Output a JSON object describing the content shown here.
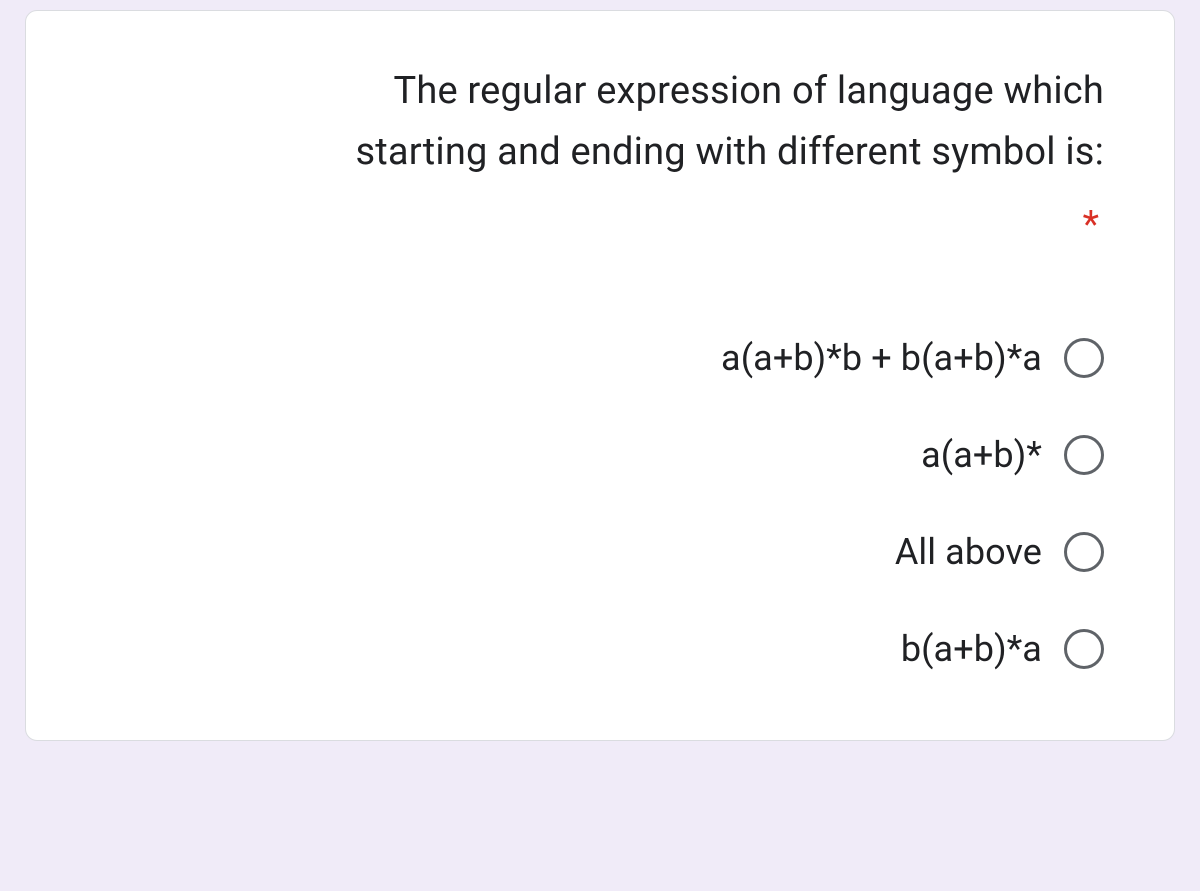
{
  "question": {
    "line1": "The regular expression of language which",
    "line2": "starting and ending with different symbol is:",
    "required_marker": "*"
  },
  "options": [
    {
      "label": "a(a+b)*b + b(a+b)*a"
    },
    {
      "label": "a(a+b)*"
    },
    {
      "label": "All above"
    },
    {
      "label": "b(a+b)*a"
    }
  ]
}
